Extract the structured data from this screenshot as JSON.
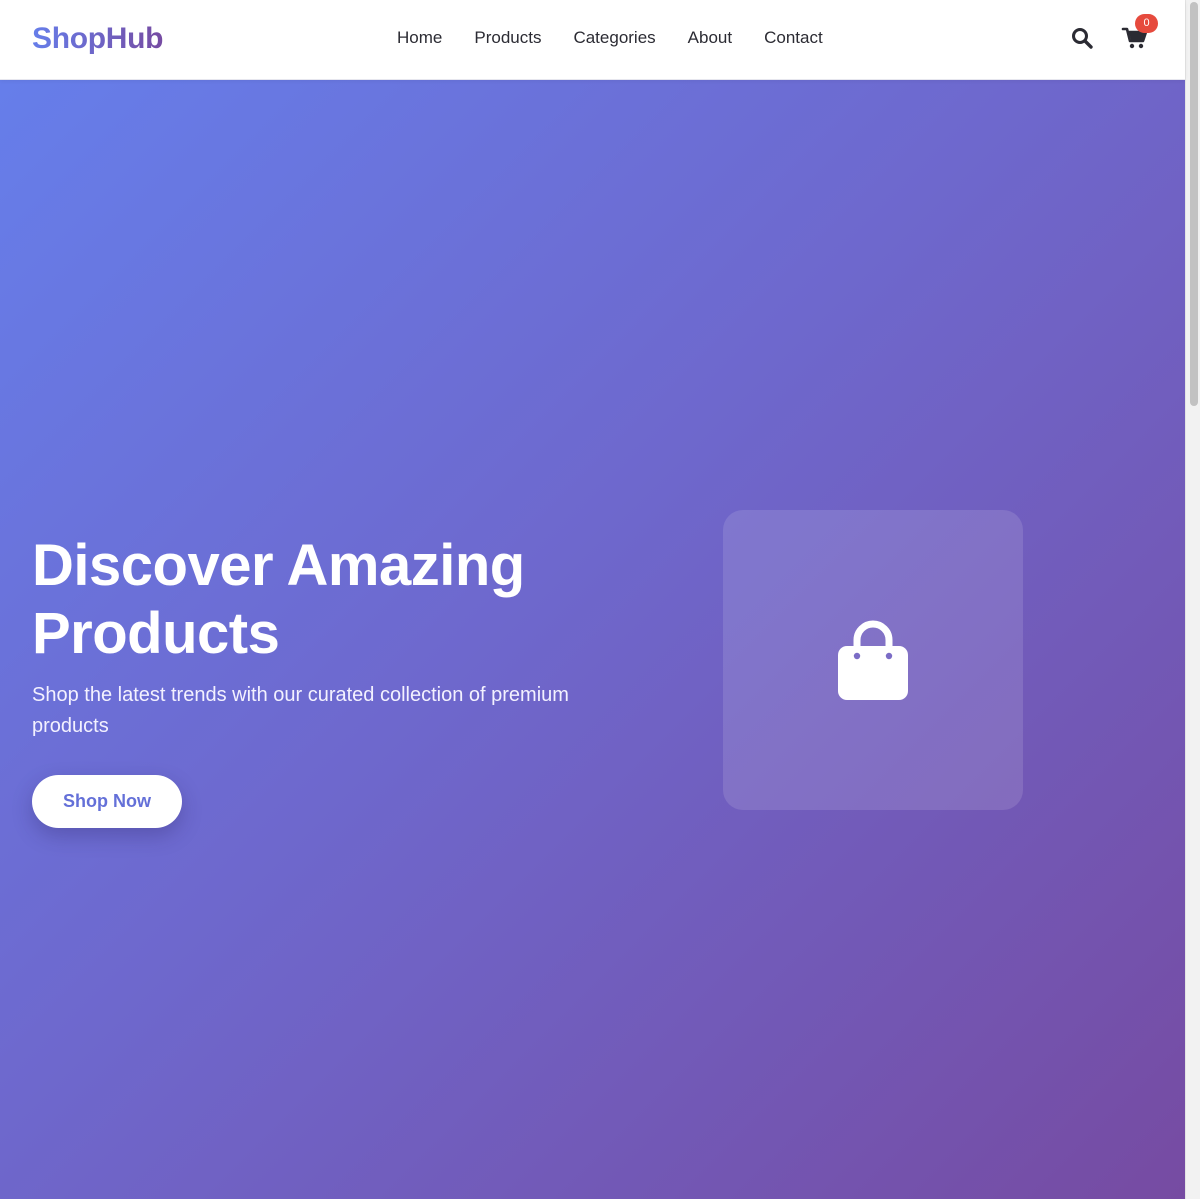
{
  "header": {
    "logo": "ShopHub",
    "nav": [
      "Home",
      "Products",
      "Categories",
      "About",
      "Contact"
    ],
    "search_icon": "search-icon",
    "cart_icon": "cart-icon",
    "cart_count": "0"
  },
  "hero": {
    "title": "Discover Amazing Products",
    "subtitle": "Shop the latest trends with our curated collection of premium products",
    "cta_label": "Shop Now",
    "image_icon": "shopping-bag-icon"
  },
  "colors": {
    "gradient_start": "#667eea",
    "gradient_end": "#764ba2",
    "badge": "#e64a3d",
    "accent_text": "#6470d8"
  }
}
